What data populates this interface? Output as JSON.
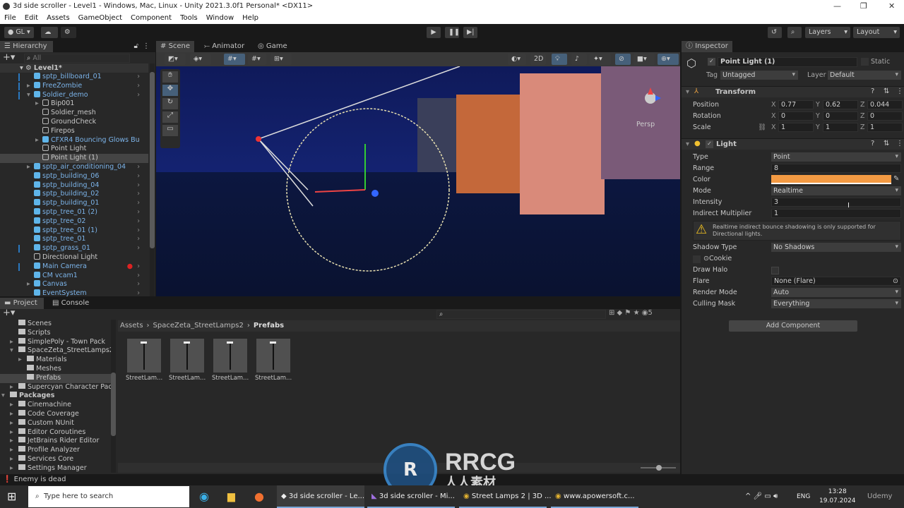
{
  "window": {
    "title": "3d side scroller - Level1 - Windows, Mac, Linux - Unity 2021.3.0f1 Personal* <DX11>"
  },
  "menu": [
    "File",
    "Edit",
    "Assets",
    "GameObject",
    "Component",
    "Tools",
    "Window",
    "Help"
  ],
  "toolbar": {
    "account": "GL",
    "layers": "Layers",
    "layout": "Layout"
  },
  "hierarchy": {
    "tab": "Hierarchy",
    "search_placeholder": "All",
    "scene": "Level1*",
    "items": [
      {
        "label": "sptp_billboard_01",
        "depth": 1,
        "prefab": true,
        "exp": false
      },
      {
        "label": "FreeZombie",
        "depth": 1,
        "prefab": true,
        "exp": "collapsed"
      },
      {
        "label": "Soldier_demo",
        "depth": 1,
        "prefab": true,
        "exp": "expanded"
      },
      {
        "label": "Bip001",
        "depth": 2,
        "prefab": false,
        "exp": "collapsed"
      },
      {
        "label": "Soldier_mesh",
        "depth": 2,
        "prefab": false
      },
      {
        "label": "GroundCheck",
        "depth": 2,
        "prefab": false
      },
      {
        "label": "Firepos",
        "depth": 2,
        "prefab": false
      },
      {
        "label": "CFXR4 Bouncing Glows Bu",
        "depth": 2,
        "prefab": true,
        "exp": "collapsed"
      },
      {
        "label": "Point Light",
        "depth": 2,
        "prefab": false
      },
      {
        "label": "Point Light (1)",
        "depth": 2,
        "prefab": false,
        "selected": true
      },
      {
        "label": "sptp_air_conditioning_04",
        "depth": 1,
        "prefab": true,
        "exp": "collapsed"
      },
      {
        "label": "sptp_building_06",
        "depth": 1,
        "prefab": true
      },
      {
        "label": "sptp_building_04",
        "depth": 1,
        "prefab": true
      },
      {
        "label": "sptp_building_02",
        "depth": 1,
        "prefab": true
      },
      {
        "label": "sptp_building_01",
        "depth": 1,
        "prefab": true
      },
      {
        "label": "sptp_tree_01 (2)",
        "depth": 1,
        "prefab": true
      },
      {
        "label": "sptp_tree_02",
        "depth": 1,
        "prefab": true
      },
      {
        "label": "sptp_tree_01 (1)",
        "depth": 1,
        "prefab": true
      },
      {
        "label": "sptp_tree_01",
        "depth": 1,
        "prefab": true
      },
      {
        "label": "sptp_grass_01",
        "depth": 1,
        "prefab": true
      },
      {
        "label": "Directional Light",
        "depth": 1,
        "prefab": false
      },
      {
        "label": "Main Camera",
        "depth": 1,
        "prefab": true
      },
      {
        "label": "CM vcam1",
        "depth": 1,
        "prefab": true
      },
      {
        "label": "Canvas",
        "depth": 1,
        "prefab": true,
        "exp": "collapsed"
      },
      {
        "label": "EventSystem",
        "depth": 1,
        "prefab": true
      }
    ]
  },
  "scene": {
    "tabs": [
      "Scene",
      "Animator",
      "Game"
    ],
    "btn_2d": "2D",
    "persp": "Persp"
  },
  "inspector": {
    "tab": "Inspector",
    "object_name": "Point Light (1)",
    "static": "Static",
    "tag_label": "Tag",
    "tag": "Untagged",
    "layer_label": "Layer",
    "layer": "Default",
    "transform": {
      "title": "Transform",
      "rows": [
        {
          "label": "Position",
          "x": "0.77",
          "y": "0.62",
          "z": "0.044"
        },
        {
          "label": "Rotation",
          "x": "0",
          "y": "0",
          "z": "0"
        },
        {
          "label": "Scale",
          "x": "1",
          "y": "1",
          "z": "1"
        }
      ]
    },
    "light": {
      "title": "Light",
      "type_label": "Type",
      "type": "Point",
      "range_label": "Range",
      "range": "8",
      "color_label": "Color",
      "color": "#f39a43",
      "mode_label": "Mode",
      "mode": "Realtime",
      "intensity_label": "Intensity",
      "intensity": "3",
      "indirect_label": "Indirect Multiplier",
      "indirect": "1",
      "warning": "Realtime indirect bounce shadowing is only supported for Directional lights.",
      "shadow_label": "Shadow Type",
      "shadow": "No Shadows",
      "cookie_label": "Cookie",
      "halo_label": "Draw Halo",
      "flare_label": "Flare",
      "flare": "None (Flare)",
      "render_label": "Render Mode",
      "render": "Auto",
      "culling_label": "Culling Mask",
      "culling": "Everything"
    },
    "add_component": "Add Component"
  },
  "project": {
    "tabs": [
      "Project",
      "Console"
    ],
    "tree": [
      {
        "label": "Scenes",
        "depth": 1
      },
      {
        "label": "Scripts",
        "depth": 1
      },
      {
        "label": "SimplePoly - Town Pack",
        "depth": 1,
        "exp": "collapsed"
      },
      {
        "label": "SpaceZeta_StreetLamps2",
        "depth": 1,
        "exp": "expanded"
      },
      {
        "label": "Materials",
        "depth": 2,
        "exp": "collapsed"
      },
      {
        "label": "Meshes",
        "depth": 2
      },
      {
        "label": "Prefabs",
        "depth": 2,
        "selected": true
      },
      {
        "label": "Supercyan Character Pac",
        "depth": 1,
        "exp": "collapsed"
      },
      {
        "label": "Packages",
        "depth": 0,
        "exp": "expanded",
        "bold": true
      },
      {
        "label": "Cinemachine",
        "depth": 1,
        "exp": "collapsed"
      },
      {
        "label": "Code Coverage",
        "depth": 1,
        "exp": "collapsed"
      },
      {
        "label": "Custom NUnit",
        "depth": 1,
        "exp": "collapsed"
      },
      {
        "label": "Editor Coroutines",
        "depth": 1,
        "exp": "collapsed"
      },
      {
        "label": "JetBrains Rider Editor",
        "depth": 1,
        "exp": "collapsed"
      },
      {
        "label": "Profile Analyzer",
        "depth": 1,
        "exp": "collapsed"
      },
      {
        "label": "Services Core",
        "depth": 1,
        "exp": "collapsed"
      },
      {
        "label": "Settings Manager",
        "depth": 1,
        "exp": "collapsed"
      }
    ],
    "breadcrumb": [
      "Assets",
      "SpaceZeta_StreetLamps2",
      "Prefabs"
    ],
    "assets": [
      "StreetLam...",
      "StreetLam...",
      "StreetLam...",
      "StreetLam..."
    ],
    "hidden_count": "5"
  },
  "status": {
    "message": "Enemy is dead"
  },
  "taskbar": {
    "search": "Type here to search",
    "apps": [
      "3d side scroller - Le...",
      "3d side scroller - Mi...",
      "Street Lamps 2 | 3D ...",
      "www.apowersoft.c..."
    ],
    "lang": "ENG",
    "time": "13:28",
    "date": "19.07.2024"
  },
  "watermark": {
    "text": "RRCG",
    "sub": "人人素材",
    "udemy": "Udemy"
  }
}
